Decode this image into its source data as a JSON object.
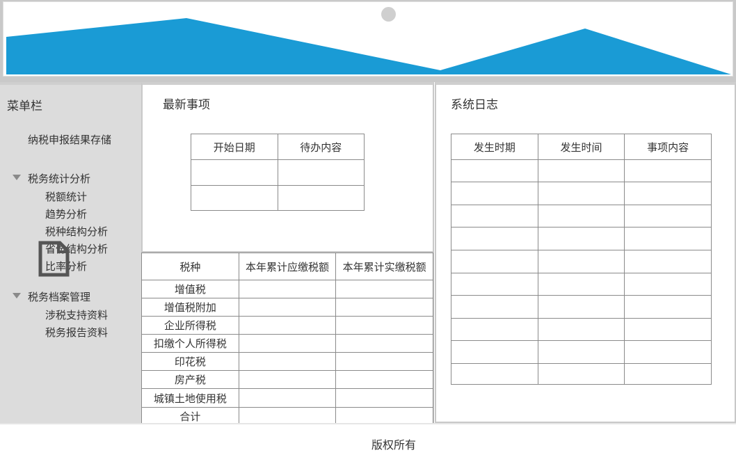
{
  "header": {
    "banner_color": "#1a9bd5"
  },
  "sidebar": {
    "title": "菜单栏",
    "top_item": "纳税申报结果存储",
    "groups": [
      {
        "label": "税务统计分析",
        "items": [
          "税额统计",
          "趋势分析",
          "税种结构分析",
          "省份结构分析",
          "比率分析"
        ]
      },
      {
        "label": "税务档案管理",
        "items": [
          "涉税支持资料",
          "税务报告资料"
        ]
      }
    ]
  },
  "latest": {
    "title": "最新事项",
    "columns": [
      "开始日期",
      "待办内容"
    ]
  },
  "tax_table": {
    "columns": [
      "税种",
      "本年累计应缴税额",
      "本年累计实缴税额"
    ],
    "rows": [
      "增值税",
      "增值税附加",
      "企业所得税",
      "扣缴个人所得税",
      "印花税",
      "房产税",
      "城镇土地使用税",
      "合计"
    ]
  },
  "log": {
    "title": "系统日志",
    "columns": [
      "发生时期",
      "发生时间",
      "事项内容"
    ]
  },
  "footer": {
    "text": "版权所有"
  }
}
